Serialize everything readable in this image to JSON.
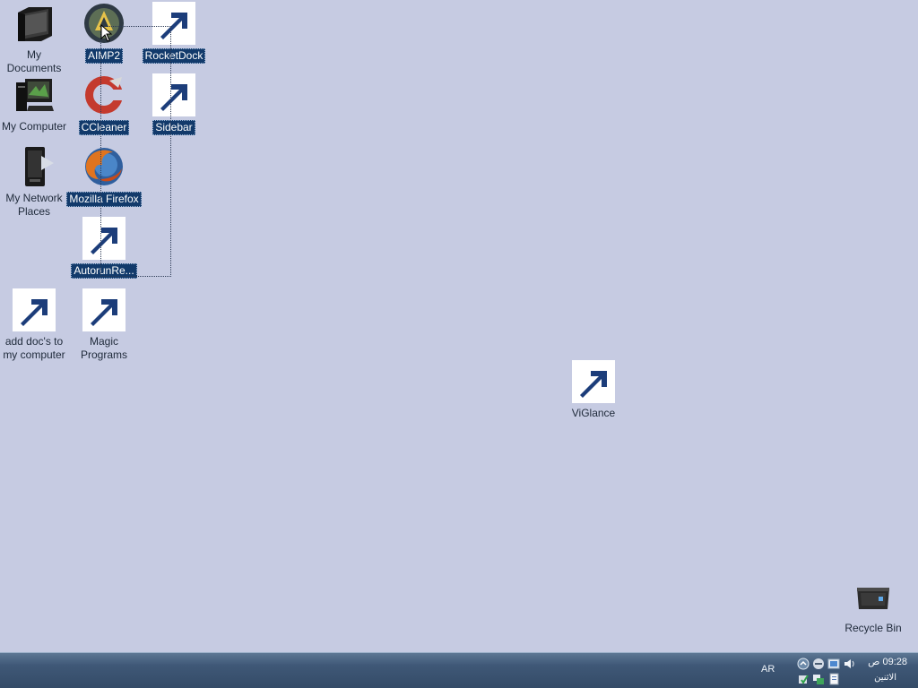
{
  "desktop": {
    "background_color": "#c6cbe2",
    "icons": {
      "my_documents": {
        "label": "My Documents",
        "icon": "folder-documents-icon"
      },
      "aimp2": {
        "label": "AIMP2",
        "icon": "aimp-player-icon",
        "selected": true
      },
      "rocketdock": {
        "label": "RocketDock",
        "icon": "rocketdock-icon",
        "selected": true
      },
      "my_computer": {
        "label": "My Computer",
        "icon": "computer-icon"
      },
      "ccleaner": {
        "label": "CCleaner",
        "icon": "ccleaner-icon",
        "selected": true
      },
      "sidebar": {
        "label": "Sidebar",
        "icon": "sidebar-icon",
        "selected": true
      },
      "my_network_places": {
        "label": "My Network Places",
        "icon": "network-places-icon"
      },
      "mozilla_firefox": {
        "label": "Mozilla Firefox",
        "icon": "firefox-icon",
        "selected": true
      },
      "autorunre": {
        "label": "AutorunRe...",
        "icon": "autorun-remover-icon",
        "selected": true
      },
      "add_docs": {
        "label": "add doc's to my computer",
        "icon": "floppy-disk-icon"
      },
      "magic_programs": {
        "label": "Magic Programs",
        "icon": "castle-icon"
      },
      "viglance": {
        "label": "ViGlance",
        "icon": "viglance-icon"
      },
      "recycle_bin": {
        "label": "Recycle Bin",
        "icon": "recycle-bin-icon"
      }
    }
  },
  "taskbar": {
    "language": "AR",
    "clock_time": "09:28 ص",
    "clock_day": "الاثنين",
    "tray_icons": [
      "expand-arrow-icon",
      "network-icon",
      "display-icon",
      "volume-icon",
      "security-icon",
      "network-connection-icon",
      "document-icon"
    ]
  }
}
